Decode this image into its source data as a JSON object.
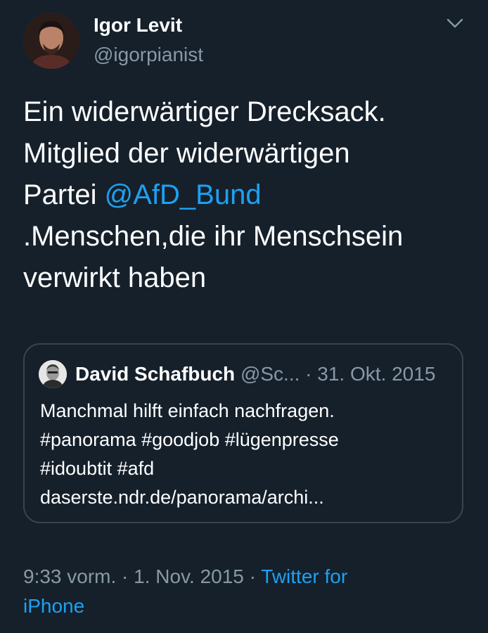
{
  "author": {
    "name": "Igor Levit",
    "handle": "@igorpianist"
  },
  "tweet": {
    "line1": "Ein widerwärtiger Drecksack.",
    "line2": "Mitglied der widerwärtigen",
    "line3_prefix": "Partei ",
    "mention": "@AfD_Bund",
    "line4": ".Menschen,die ihr Menschsein",
    "line5": "verwirkt haben"
  },
  "quoted": {
    "name": "David Schafbuch",
    "handle": "@Sc...",
    "separator": "·",
    "date": "31. Okt. 2015",
    "line1": "Manchmal hilft einfach nachfragen.",
    "line2": "#panorama #goodjob #lügenpresse",
    "line3": "#idoubtit #afd",
    "line4": "daserste.ndr.de/panorama/archi..."
  },
  "meta": {
    "time": "9:33 vorm.",
    "separator1": " · ",
    "date": "1. Nov. 2015",
    "separator2": " · ",
    "source_line1": "Twitter for",
    "source_line2": "iPhone"
  },
  "colors": {
    "background": "#15202b",
    "accent": "#1da1f2",
    "secondary_text": "#8899a6",
    "border": "#38444d"
  },
  "icons": {
    "menu": "chevron-down-icon"
  }
}
